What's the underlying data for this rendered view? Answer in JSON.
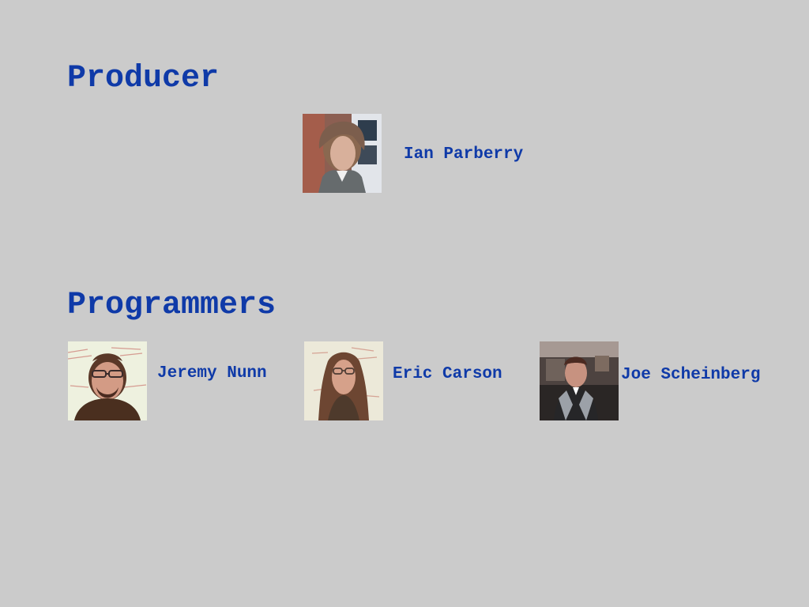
{
  "sections": {
    "producer": {
      "title": "Producer",
      "people": [
        {
          "name": "Ian Parberry",
          "photo": "portrait-photo"
        }
      ]
    },
    "programmers": {
      "title": "Programmers",
      "people": [
        {
          "name": "Jeremy Nunn",
          "photo": "portrait-photo"
        },
        {
          "name": "Eric Carson",
          "photo": "portrait-photo"
        },
        {
          "name": "Joe Scheinberg",
          "photo": "portrait-photo"
        }
      ]
    }
  },
  "colors": {
    "background": "#cbcbcb",
    "text": "#0f3aa8"
  }
}
